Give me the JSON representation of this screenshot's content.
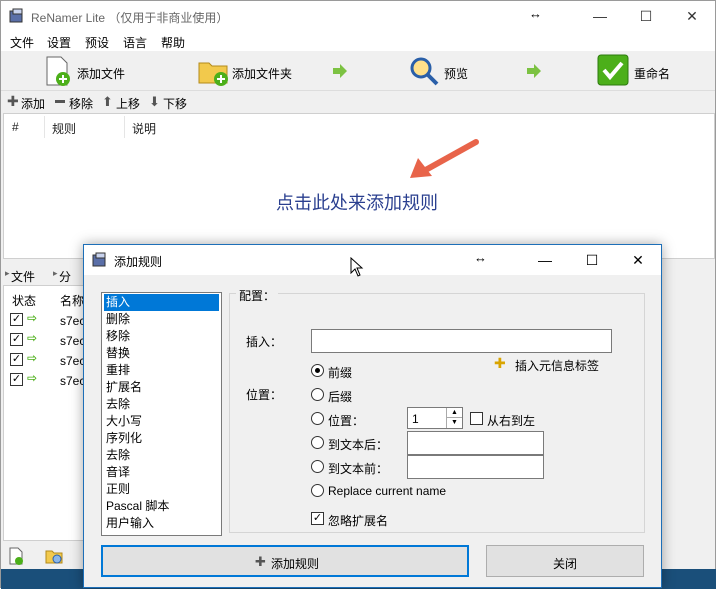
{
  "window": {
    "title": "ReNamer Lite （仅用于非商业使用）",
    "resize_glyph": "↔",
    "min_glyph": "—",
    "max_glyph": "☐",
    "close_glyph": "✕"
  },
  "menu": [
    "文件",
    "设置",
    "预设",
    "语言",
    "帮助"
  ],
  "toolbar": {
    "add_files": "添加文件",
    "add_folders": "添加文件夹",
    "preview": "预览",
    "rename": "重命名"
  },
  "rule_toolbar": {
    "add": "添加",
    "remove": "移除",
    "up": "上移",
    "down": "下移"
  },
  "rule_table": {
    "columns": [
      "#",
      "规则",
      "说明"
    ],
    "empty_hint": "点击此处来添加规则"
  },
  "file_tabs": [
    "文件",
    "分"
  ],
  "file_table": {
    "columns": [
      "状态",
      "名称"
    ],
    "rows": [
      "s7ec",
      "s7ec",
      "s7ec",
      "s7ec"
    ]
  },
  "dialog": {
    "title": "添加规则",
    "rules": [
      "插入",
      "删除",
      "移除",
      "替换",
      "重排",
      "扩展名",
      "去除",
      "大小写",
      "序列化",
      "去除",
      "音译",
      "正则",
      "Pascal 脚本",
      "用户输入"
    ],
    "selected_rule": "插入",
    "config_label": "配置：",
    "insert_label": "插入：",
    "insert_value": "",
    "meta_tag_label": "插入元信息标签",
    "position_label": "位置：",
    "options": {
      "prefix": "前缀",
      "suffix": "后缀",
      "position": "位置：",
      "after_text": "到文本后：",
      "before_text": "到文本前：",
      "replace_name": "Replace current name"
    },
    "selected_option": "前缀",
    "position_value": "1",
    "right_to_left": "从右到左",
    "ignore_ext": "忽略扩展名",
    "add_rule_button": "添加规则",
    "close_button": "关闭"
  },
  "colors": {
    "accent": "#0078d7",
    "hint_text": "#2a3f8f",
    "arrow": "#e8644a",
    "green": "#4caf1a",
    "taskbar": "#1a4f7a"
  }
}
